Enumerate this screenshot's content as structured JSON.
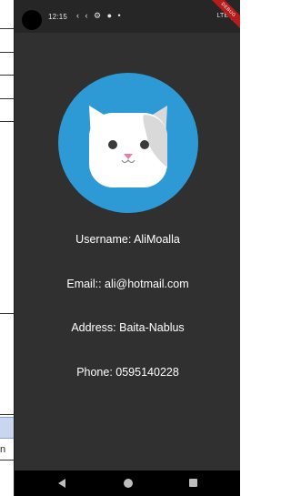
{
  "status_bar": {
    "time": "12:15",
    "notification_icons": "‹ ‹ ⚙ ● •",
    "network": "LTE",
    "debug_banner": "DEBUG"
  },
  "profile": {
    "avatar_icon": "cat-face-icon",
    "username": "Username: AliMoalla",
    "email": "Email:: ali@hotmail.com",
    "address": "Address: Baita-Nablus",
    "phone": "Phone: 0595140228"
  },
  "nav_bar": {
    "back_icon": "back-triangle-icon",
    "home_icon": "home-circle-icon",
    "recents_icon": "recents-square-icon"
  },
  "colors": {
    "app_background": "#303030",
    "avatar_background": "#2d9ad6",
    "text": "#ffffff"
  },
  "background_document": {
    "visible_fragment": "n"
  }
}
